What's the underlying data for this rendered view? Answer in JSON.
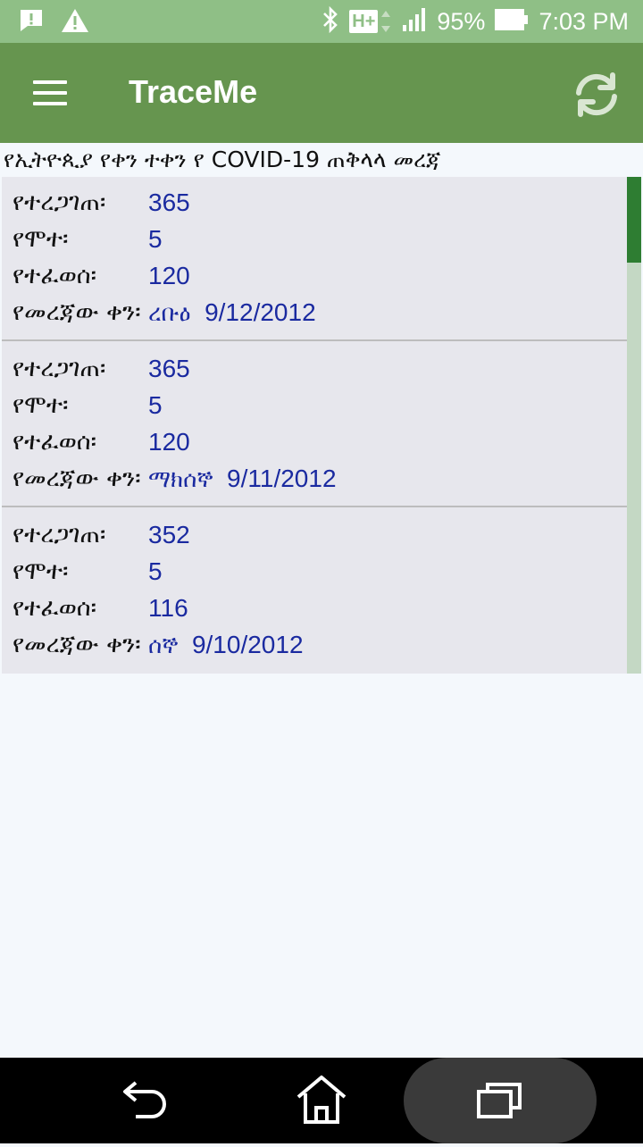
{
  "status_bar": {
    "battery": "95%",
    "time": "7:03 PM",
    "network": "H+",
    "icons": [
      "message-alert-icon",
      "warning-icon",
      "bluetooth-icon",
      "network-type-icon",
      "signal-icon",
      "battery-icon"
    ]
  },
  "app_bar": {
    "title": "TraceMe",
    "menu_icon": "hamburger-menu-icon",
    "refresh_icon": "refresh-icon"
  },
  "page": {
    "heading": "የኢትዮጲያ የቀን ተቀን የ COVID-19 ጠቅላላ መረጃ"
  },
  "reports": [
    {
      "confirmed_label": "የተረጋገጠ፡",
      "confirmed": "365",
      "deaths_label": "የሞተ፡",
      "deaths": "5",
      "recovered_label": "የተፈወሰ፡",
      "recovered": "120",
      "date_label": "የመረጃው ቀን፡",
      "weekday": "ረቡዕ",
      "date": "9/12/2012"
    },
    {
      "confirmed_label": "የተረጋገጠ፡",
      "confirmed": "365",
      "deaths_label": "የሞተ፡",
      "deaths": "5",
      "recovered_label": "የተፈወሰ፡",
      "recovered": "120",
      "date_label": "የመረጃው ቀን፡",
      "weekday": "ማክሰኞ",
      "date": "9/11/2012"
    },
    {
      "confirmed_label": "የተረጋገጠ፡",
      "confirmed": "352",
      "deaths_label": "የሞተ፡",
      "deaths": "5",
      "recovered_label": "የተፈወሰ፡",
      "recovered": "116",
      "date_label": "የመረጃው ቀን፡",
      "weekday": "ሰኞ",
      "date": "9/10/2012"
    }
  ],
  "nav_bar": {
    "icons": [
      "back-icon",
      "home-icon",
      "recents-icon"
    ]
  },
  "colors": {
    "status_bar": "#8fbf86",
    "app_bar": "#66954f",
    "value_text": "#1a2aa0",
    "scroll_thumb": "#2e7d32"
  }
}
